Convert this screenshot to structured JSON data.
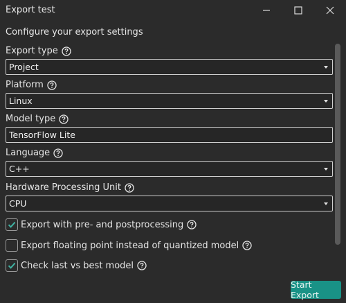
{
  "window": {
    "title": "Export test"
  },
  "heading": "Configure your export settings",
  "fields": {
    "export_type": {
      "label": "Export type",
      "value": "Project"
    },
    "platform": {
      "label": "Platform",
      "value": "Linux"
    },
    "model_type": {
      "label": "Model type",
      "value": "TensorFlow Lite"
    },
    "language": {
      "label": "Language",
      "value": "C++"
    },
    "hardware": {
      "label": "Hardware Processing Unit",
      "value": "CPU"
    }
  },
  "options": {
    "pre_post": {
      "label": "Export with pre- and postprocessing",
      "checked": true
    },
    "floating_point": {
      "label": "Export floating point instead of quantized model",
      "checked": false
    },
    "last_vs_best": {
      "label": "Check last vs best model",
      "checked": true
    }
  },
  "actions": {
    "start_export": "Start Export"
  },
  "icons": {
    "help": "help-circle-icon",
    "check": "checkmark-icon",
    "minimize": "minimize-icon",
    "maximize": "maximize-icon",
    "close": "close-icon"
  },
  "colors": {
    "accent": "#199286",
    "check": "#3fb3a3",
    "background": "#2b2b2b"
  }
}
